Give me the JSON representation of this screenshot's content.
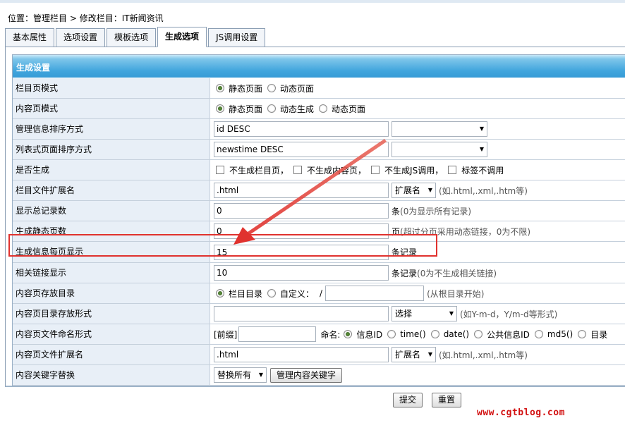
{
  "breadcrumb": {
    "prefix": "位置：",
    "root": "管理栏目",
    "separator": " > ",
    "current": "修改栏目：IT新闻资讯"
  },
  "tabs": [
    {
      "label": "基本属性",
      "active": false
    },
    {
      "label": "选项设置",
      "active": false
    },
    {
      "label": "模板选项",
      "active": false
    },
    {
      "label": "生成选项",
      "active": true
    },
    {
      "label": "JS调用设置",
      "active": false
    }
  ],
  "section_title": "生成设置",
  "rows": {
    "list_mode": {
      "label": "栏目页模式",
      "options": [
        "静态页面",
        "动态页面"
      ],
      "selected": "静态页面"
    },
    "content_mode": {
      "label": "内容页模式",
      "options": [
        "静态页面",
        "动态生成",
        "动态页面"
      ],
      "selected": "静态页面"
    },
    "manage_order": {
      "label": "管理信息排序方式",
      "value": "id DESC",
      "select_value": ""
    },
    "list_order": {
      "label": "列表式页面排序方式",
      "value": "newstime DESC",
      "select_value": ""
    },
    "generate": {
      "label": "是否生成",
      "options": [
        "不生成栏目页，",
        "不生成内容页，",
        "不生成JS调用，",
        "标签不调用"
      ]
    },
    "list_ext": {
      "label": "栏目文件扩展名",
      "value": ".html",
      "select_value": "扩展名",
      "hint": "(如.html,.xml,.htm等)"
    },
    "total_records": {
      "label": "显示总记录数",
      "value": "0",
      "unit": "条",
      "hint": "(0为显示所有记录)"
    },
    "static_pages": {
      "label": "生成静态页数",
      "value": "0",
      "unit": "页",
      "hint": "(超过分页采用动态链接，0为不限)"
    },
    "per_page": {
      "label": "生成信息每页显示",
      "value": "15",
      "unit": "条记录"
    },
    "related_links": {
      "label": "相关链接显示",
      "value": "10",
      "unit": "条记录",
      "hint": "(0为不生成相关链接)"
    },
    "content_dir": {
      "label": "内容页存放目录",
      "options": [
        "栏目目录",
        "自定义："
      ],
      "selected": "栏目目录",
      "slash": "/",
      "value": "",
      "hint": "(从根目录开始)"
    },
    "dir_format": {
      "label": "内容页目录存放形式",
      "value": "",
      "select_value": "选择",
      "hint": "(如Y-m-d，Y/m-d等形式)"
    },
    "file_naming": {
      "label": "内容页文件命名形式",
      "prefix_label": "[前缀]",
      "prefix_value": "",
      "name_label": "命名:",
      "options": [
        "信息ID",
        "time()",
        "date()",
        "公共信息ID",
        "md5()",
        "目录"
      ],
      "selected": "信息ID"
    },
    "content_ext": {
      "label": "内容页文件扩展名",
      "value": ".html",
      "select_value": "扩展名",
      "hint": "(如.html,.xml,.htm等)"
    },
    "keyword_replace": {
      "label": "内容关键字替换",
      "select_value": "替换所有",
      "button": "管理内容关键字"
    }
  },
  "buttons": {
    "submit": "提交",
    "reset": "重置"
  },
  "watermark": "www.cgtblog.com",
  "colors": {
    "header_blue": "#41a5dd",
    "label_bg": "#e8eff7",
    "highlight_red": "#e0322e",
    "watermark_red": "#d21010"
  }
}
